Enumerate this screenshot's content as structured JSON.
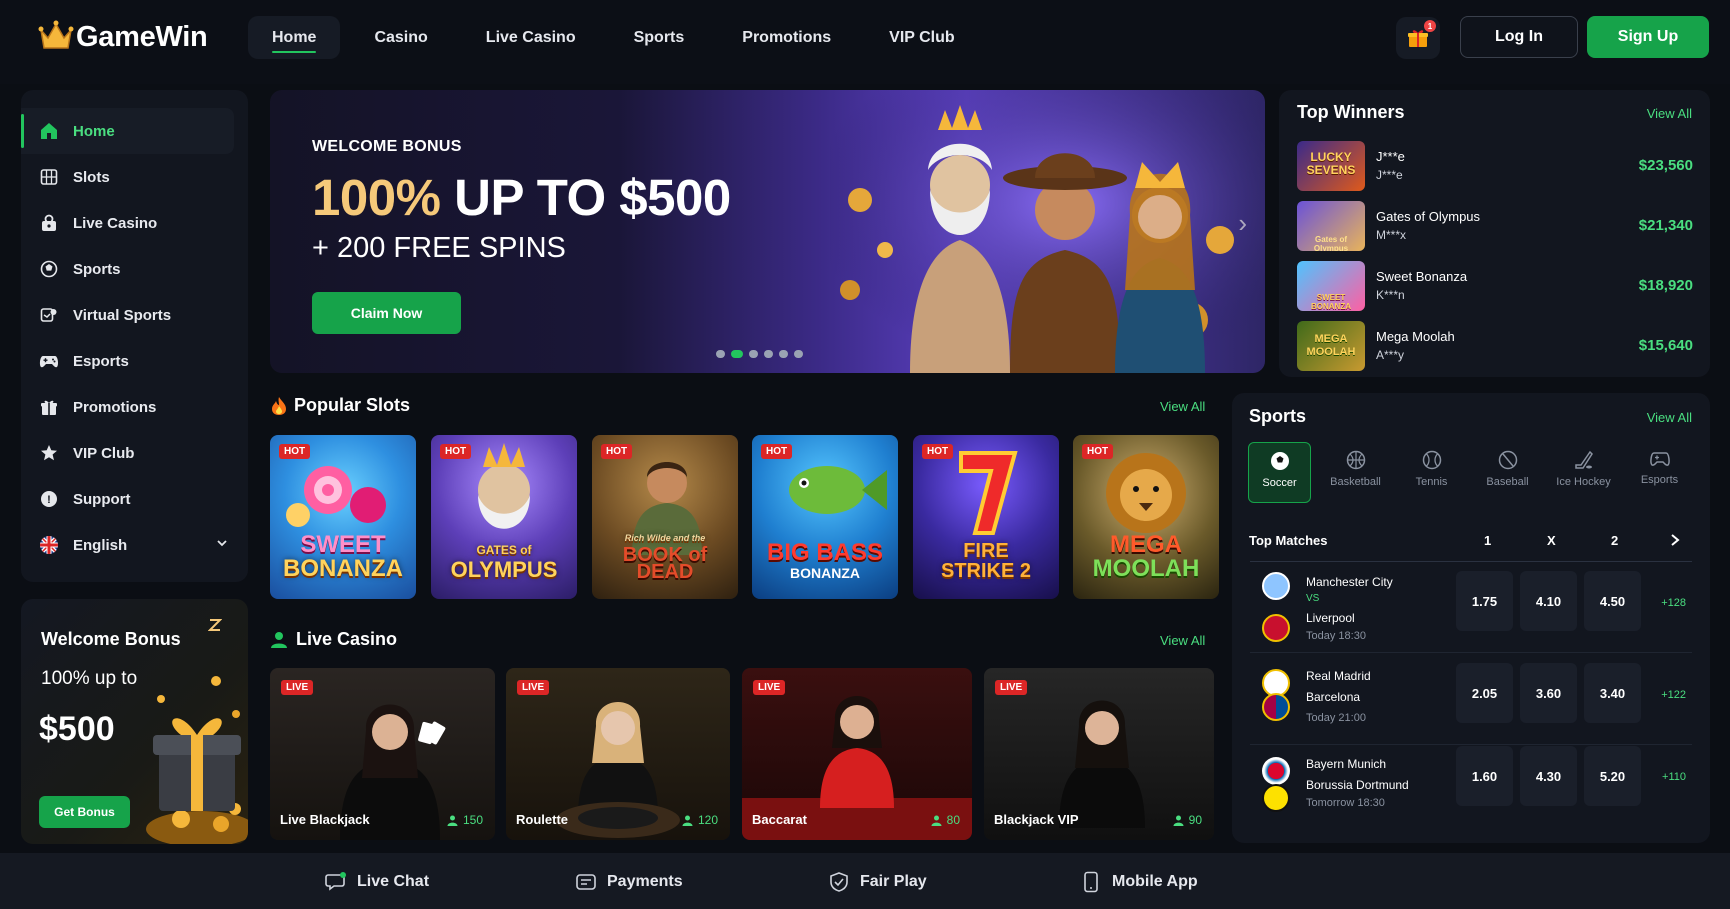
{
  "brand": {
    "name": "GameWin"
  },
  "nav": [
    "Home",
    "Casino",
    "Live Casino",
    "Sports",
    "Promotions",
    "VIP Club"
  ],
  "header": {
    "gift_badge": "1",
    "login": "Log In",
    "signup": "Sign Up"
  },
  "sidebar": {
    "items": [
      {
        "label": "Home",
        "icon": "home-icon"
      },
      {
        "label": "Slots",
        "icon": "slots-icon"
      },
      {
        "label": "Live Casino",
        "icon": "live-casino-icon"
      },
      {
        "label": "Sports",
        "icon": "sports-ball-icon"
      },
      {
        "label": "Virtual Sports",
        "icon": "virtual-sports-icon"
      },
      {
        "label": "Esports",
        "icon": "gamepad-icon"
      },
      {
        "label": "Promotions",
        "icon": "gift-icon"
      },
      {
        "label": "VIP Club",
        "icon": "star-icon"
      },
      {
        "label": "Support",
        "icon": "support-icon"
      }
    ],
    "language": "English"
  },
  "bonus_card": {
    "title": "Welcome Bonus",
    "line": "100% up to",
    "amount": "$500",
    "button": "Get Bonus"
  },
  "hero": {
    "eyebrow": "WELCOME BONUS",
    "headline_gold": "100%",
    "headline_rest": " UP TO $500",
    "sub": "+ 200 FREE SPINS",
    "cta": "Claim Now",
    "active_slide": 2,
    "slides": 6
  },
  "popular_slots": {
    "title": "Popular Slots",
    "view_all": "View All",
    "badge": "HOT",
    "games": [
      {
        "line1": "SWEET",
        "line2": "BONANZA"
      },
      {
        "line1": "GATES of",
        "line2": "OLYMPUS"
      },
      {
        "line1": "Rich Wilde and the",
        "line2": "BOOK of DEAD"
      },
      {
        "line1": "BIG BASS",
        "line2": "BONANZA"
      },
      {
        "line1": "FIRE",
        "line2": "STRIKE 2"
      },
      {
        "line1": "MEGA",
        "line2": "MOOLAH"
      }
    ]
  },
  "live_casino": {
    "title": "Live Casino",
    "view_all": "View All",
    "badge": "LIVE",
    "tables": [
      {
        "name": "Live Blackjack",
        "players": "150"
      },
      {
        "name": "Roulette",
        "players": "120"
      },
      {
        "name": "Baccarat",
        "players": "80"
      },
      {
        "name": "Blackjack VIP",
        "players": "90"
      }
    ]
  },
  "top_winners": {
    "title": "Top Winners",
    "view_all": "View All",
    "rows": [
      {
        "game": "J***e",
        "user": "J***e",
        "amount": "$23,560",
        "thumb": "LUCKY SEVENS"
      },
      {
        "game": "Gates of Olympus",
        "user": "M***x",
        "amount": "$21,340",
        "thumb": "Gates of Olympus"
      },
      {
        "game": "Sweet Bonanza",
        "user": "K***n",
        "amount": "$18,920",
        "thumb": "SWEET BONANZA"
      },
      {
        "game": "Mega Moolah",
        "user": "A***y",
        "amount": "$15,640",
        "thumb": "MEGA MOOLAH"
      }
    ]
  },
  "sports": {
    "title": "Sports",
    "view_all": "View All",
    "tabs": [
      "Soccer",
      "Basketball",
      "Tennis",
      "Baseball",
      "Ice Hockey",
      "Esports"
    ],
    "top_matches": "Top Matches",
    "col1": "1",
    "colx": "X",
    "col2": "2",
    "vs": "VS",
    "matches": [
      {
        "home": "Manchester City",
        "away": "Liverpool",
        "time": "Today 18:30",
        "o1": "1.75",
        "ox": "4.10",
        "o2": "4.50",
        "more": "+128"
      },
      {
        "home": "Real Madrid",
        "away": "Barcelona",
        "time": "Today 21:00",
        "o1": "2.05",
        "ox": "3.60",
        "o2": "3.40",
        "more": "+122"
      },
      {
        "home": "Bayern Munich",
        "away": "Borussia Dortmund",
        "time": "Tomorrow 18:30",
        "o1": "1.60",
        "ox": "4.30",
        "o2": "5.20",
        "more": "+110"
      }
    ]
  },
  "footer": [
    "Live Chat",
    "Payments",
    "Fair Play",
    "Mobile App"
  ],
  "colors": {
    "accent": "#22c55e",
    "brand_gold": "#f5c97a",
    "hot": "#dc2626",
    "bg": "#0b0e14"
  }
}
